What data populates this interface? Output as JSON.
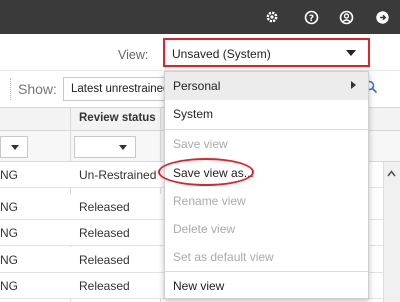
{
  "colors": {
    "topbar": "#3a3a3a",
    "highlight_red": "#e0232b"
  },
  "topbar": {
    "icons": [
      "gear-icon",
      "help-icon",
      "user-icon",
      "logout-icon"
    ]
  },
  "view": {
    "label": "View:",
    "selected": "Unsaved (System)"
  },
  "show": {
    "label": "Show:",
    "selected": "Latest unrestrained"
  },
  "table": {
    "columns": [
      "",
      "Review status"
    ],
    "rows": [
      {
        "c1": "NG",
        "c2": "Un-Restrained"
      },
      {
        "c1": "NG",
        "c2": "Released"
      },
      {
        "c1": "NG",
        "c2": "Released"
      },
      {
        "c1": "NG",
        "c2": "Released"
      },
      {
        "c1": "NG",
        "c2": "Released"
      }
    ]
  },
  "menu": {
    "items": [
      {
        "label": "Personal",
        "disabled": false,
        "submenu": true
      },
      {
        "label": "System",
        "disabled": false
      },
      {
        "label": "Save view",
        "disabled": true
      },
      {
        "label": "Save view as...",
        "disabled": false
      },
      {
        "label": "Rename view",
        "disabled": true
      },
      {
        "label": "Delete view",
        "disabled": true
      },
      {
        "label": "Set as default view",
        "disabled": true
      },
      {
        "label": "New view",
        "disabled": false
      }
    ]
  }
}
